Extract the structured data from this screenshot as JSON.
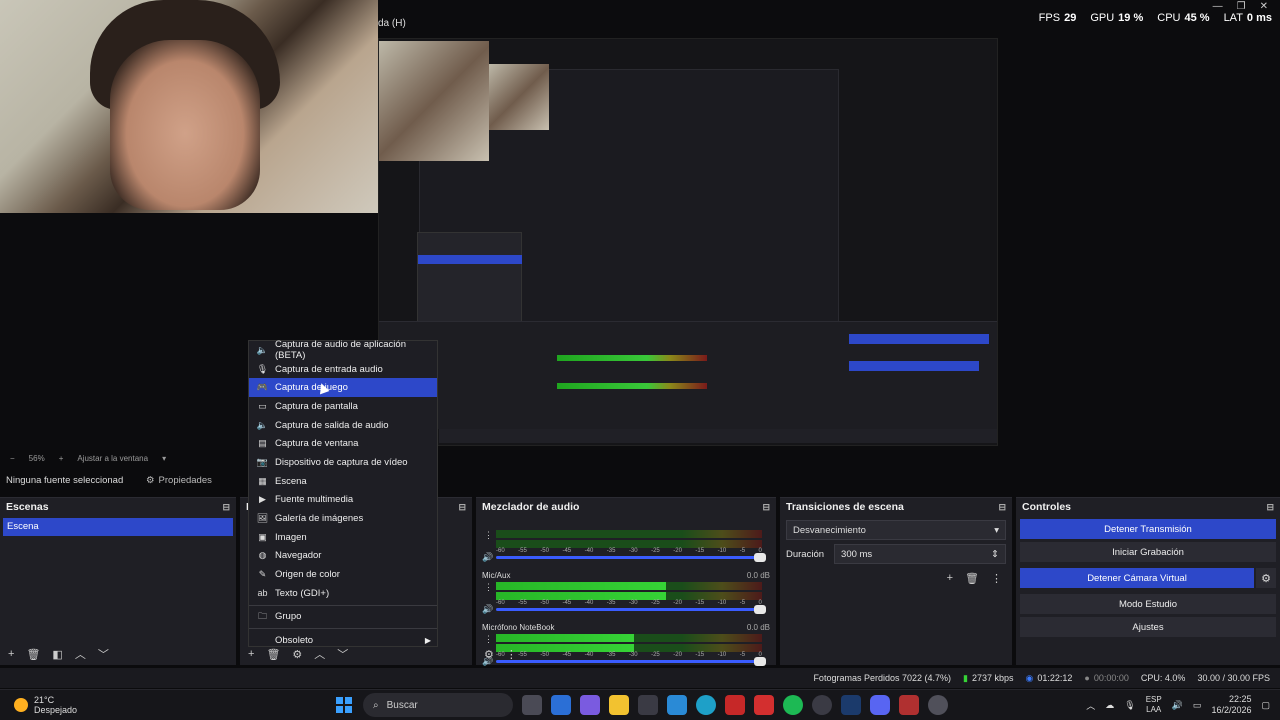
{
  "window": {
    "title_fragment": "da (H)"
  },
  "stats": {
    "fps_label": "FPS",
    "fps": "29",
    "gpu_label": "GPU",
    "gpu": "19 %",
    "cpu_label": "CPU",
    "cpu": "45 %",
    "lat_label": "LAT",
    "lat": "0 ms"
  },
  "zoombar": {
    "zoom": "56%",
    "fit": "Ajustar a la ventana"
  },
  "sourcebar": {
    "none_selected": "Ninguna fuente seleccionad",
    "properties": "Propiedades"
  },
  "scenes": {
    "title": "Escenas",
    "items": [
      {
        "label": "Escena"
      }
    ]
  },
  "sources": {
    "title": "F"
  },
  "mixer": {
    "title": "Mezclador de audio",
    "scale": [
      "-60",
      "-55",
      "-50",
      "-45",
      "-40",
      "-35",
      "-30",
      "-25",
      "-20",
      "-15",
      "-10",
      "-5",
      "0"
    ],
    "channels": [
      {
        "name": "",
        "db": "",
        "level": 0.0
      },
      {
        "name": "Mic/Aux",
        "db": "0.0 dB",
        "level": 0.64
      },
      {
        "name": "Micrófono NoteBook",
        "db": "0.0 dB",
        "level": 0.52
      }
    ]
  },
  "transitions": {
    "title": "Transiciones de escena",
    "selected": "Desvanecimiento",
    "duration_label": "Duración",
    "duration": "300 ms"
  },
  "controls": {
    "title": "Controles",
    "stop_stream": "Detener Transmisión",
    "start_recording": "Iniciar Grabación",
    "stop_vcam": "Detener Cámara Virtual",
    "studio_mode": "Modo Estudio",
    "settings": "Ajustes"
  },
  "status": {
    "dropped_frames": "Fotogramas Perdidos 7022 (4.7%)",
    "bitrate": "2737 kbps",
    "stream_time": "01:22:12",
    "rec_time": "00:00:00",
    "cpu": "CPU: 4.0%",
    "fps": "30.00 / 30.00 FPS"
  },
  "menu": {
    "items": [
      {
        "label": "Captura de audio de aplicación (BETA)",
        "icon": "speaker-icon"
      },
      {
        "label": "Captura de entrada audio",
        "icon": "mic-icon"
      },
      {
        "label": "Captura de juego",
        "icon": "gamepad-icon",
        "selected": true
      },
      {
        "label": "Captura de pantalla",
        "icon": "monitor-icon"
      },
      {
        "label": "Captura de salida de audio",
        "icon": "speaker-icon"
      },
      {
        "label": "Captura de ventana",
        "icon": "window-icon"
      },
      {
        "label": "Dispositivo de captura de vídeo",
        "icon": "camera-icon"
      },
      {
        "label": "Escena",
        "icon": "scene-icon"
      },
      {
        "label": "Fuente multimedia",
        "icon": "play-icon"
      },
      {
        "label": "Galería de imágenes",
        "icon": "gallery-icon"
      },
      {
        "label": "Imagen",
        "icon": "image-icon"
      },
      {
        "label": "Navegador",
        "icon": "globe-icon"
      },
      {
        "label": "Origen de color",
        "icon": "brush-icon"
      },
      {
        "label": "Texto (GDI+)",
        "icon": "text-icon"
      }
    ],
    "group": "Grupo",
    "obsolete": "Obsoleto"
  },
  "taskbar": {
    "temp": "21°C",
    "weather": "Despejado",
    "search": "Buscar",
    "lang1": "ESP",
    "lang2": "LAA",
    "time": "22:25",
    "date": "16/2/2026"
  },
  "colors": {
    "accent": "#2d48c9",
    "panel": "#1f1f25",
    "meter_green": "#36d336"
  }
}
